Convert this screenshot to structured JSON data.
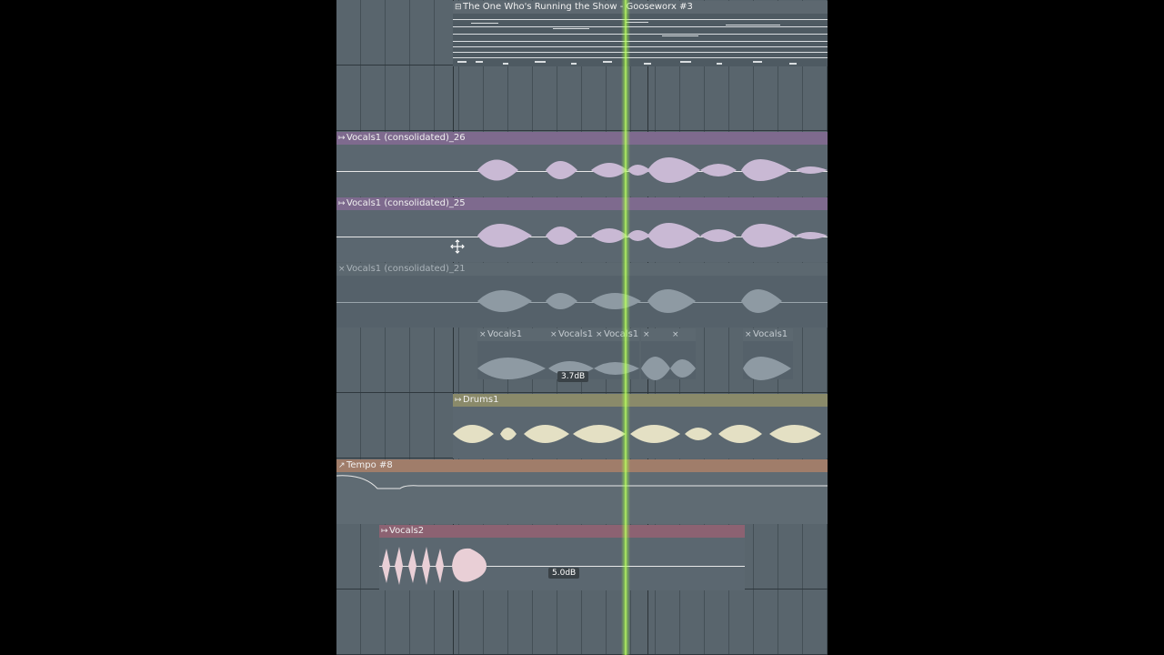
{
  "pattern_clip": {
    "title": "The One Who's Running the Show - Gooseworx #3",
    "icon": "pattern-icon"
  },
  "audio_tracks": [
    {
      "label": "Vocals1 (consolidated)_26",
      "icon": "audio-clip-icon",
      "muted": false
    },
    {
      "label": "Vocals1 (consolidated)_25",
      "icon": "audio-clip-icon",
      "muted": false
    },
    {
      "label": "Vocals1 (consolidated)_21",
      "icon": "close-icon",
      "muted": true
    }
  ],
  "split_clips": [
    {
      "label": "Vocals1",
      "icon": "close-icon"
    },
    {
      "label": "Vocals1",
      "icon": "close-icon"
    },
    {
      "label": "Vocals1",
      "icon": "close-icon"
    },
    {
      "label": "",
      "icon": "close-icon"
    },
    {
      "label": "",
      "icon": "close-icon"
    },
    {
      "label": "Vocals1",
      "icon": "close-icon"
    }
  ],
  "split_gain_badge": "3.7dB",
  "drums_clip": {
    "label": "Drums1",
    "icon": "audio-clip-icon"
  },
  "tempo_clip": {
    "label": "Tempo #8",
    "icon": "automation-icon"
  },
  "vocals2_clip": {
    "label": "Vocals2",
    "icon": "audio-clip-icon",
    "gain_badge": "5.0dB"
  },
  "colors": {
    "pattern_header": "#5d6870",
    "vocal_header": "#7e6a8e",
    "vocal_wave": "#c9b9d4",
    "muted_header": "#5c6870",
    "muted_wave": "#8e9aa3",
    "drums_header": "#8a8a6a",
    "drums_wave": "#e4e0c4",
    "tempo_header": "#a07d6a",
    "vocals2_header": "#8c6272",
    "vocals2_wave": "#e9cfd6",
    "playhead": "#b8ff5a"
  }
}
